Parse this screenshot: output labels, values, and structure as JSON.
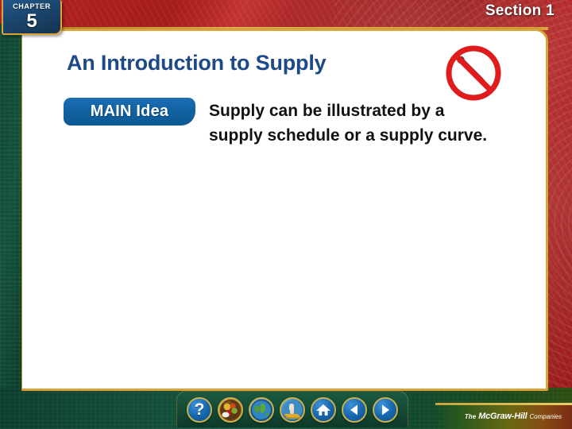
{
  "slide": {
    "chapter": {
      "word": "CHAPTER",
      "number": "5"
    },
    "section": "Section 1",
    "title": "An Introduction to Supply",
    "main_idea": {
      "badge_label": "MAIN Idea",
      "text": "Supply can be illustrated by a supply schedule or a supply curve."
    },
    "decoration_icon": "no-pen-prohibition-icon"
  },
  "toolbar": {
    "buttons": [
      {
        "name": "help-button",
        "icon": "question-mark-icon",
        "label": "?"
      },
      {
        "name": "resources-button",
        "icon": "food-basket-icon",
        "label": ""
      },
      {
        "name": "globe-button",
        "icon": "globe-icon",
        "label": ""
      },
      {
        "name": "activity-button",
        "icon": "gold-bar-hand-icon",
        "label": ""
      },
      {
        "name": "home-button",
        "icon": "home-icon",
        "label": ""
      },
      {
        "name": "previous-button",
        "icon": "arrow-left-icon",
        "label": ""
      },
      {
        "name": "next-button",
        "icon": "arrow-right-icon",
        "label": ""
      }
    ]
  },
  "footer": {
    "logo_the": "The",
    "logo_name": "McGraw-Hill",
    "logo_companies": "Companies"
  },
  "colors": {
    "title_blue": "#1d4a86",
    "badge_blue": "#11619f",
    "frame_gold": "#d9a43a",
    "bg_red": "#a61d1d",
    "bg_green": "#134733",
    "prohibition_red": "#e01b1b"
  }
}
